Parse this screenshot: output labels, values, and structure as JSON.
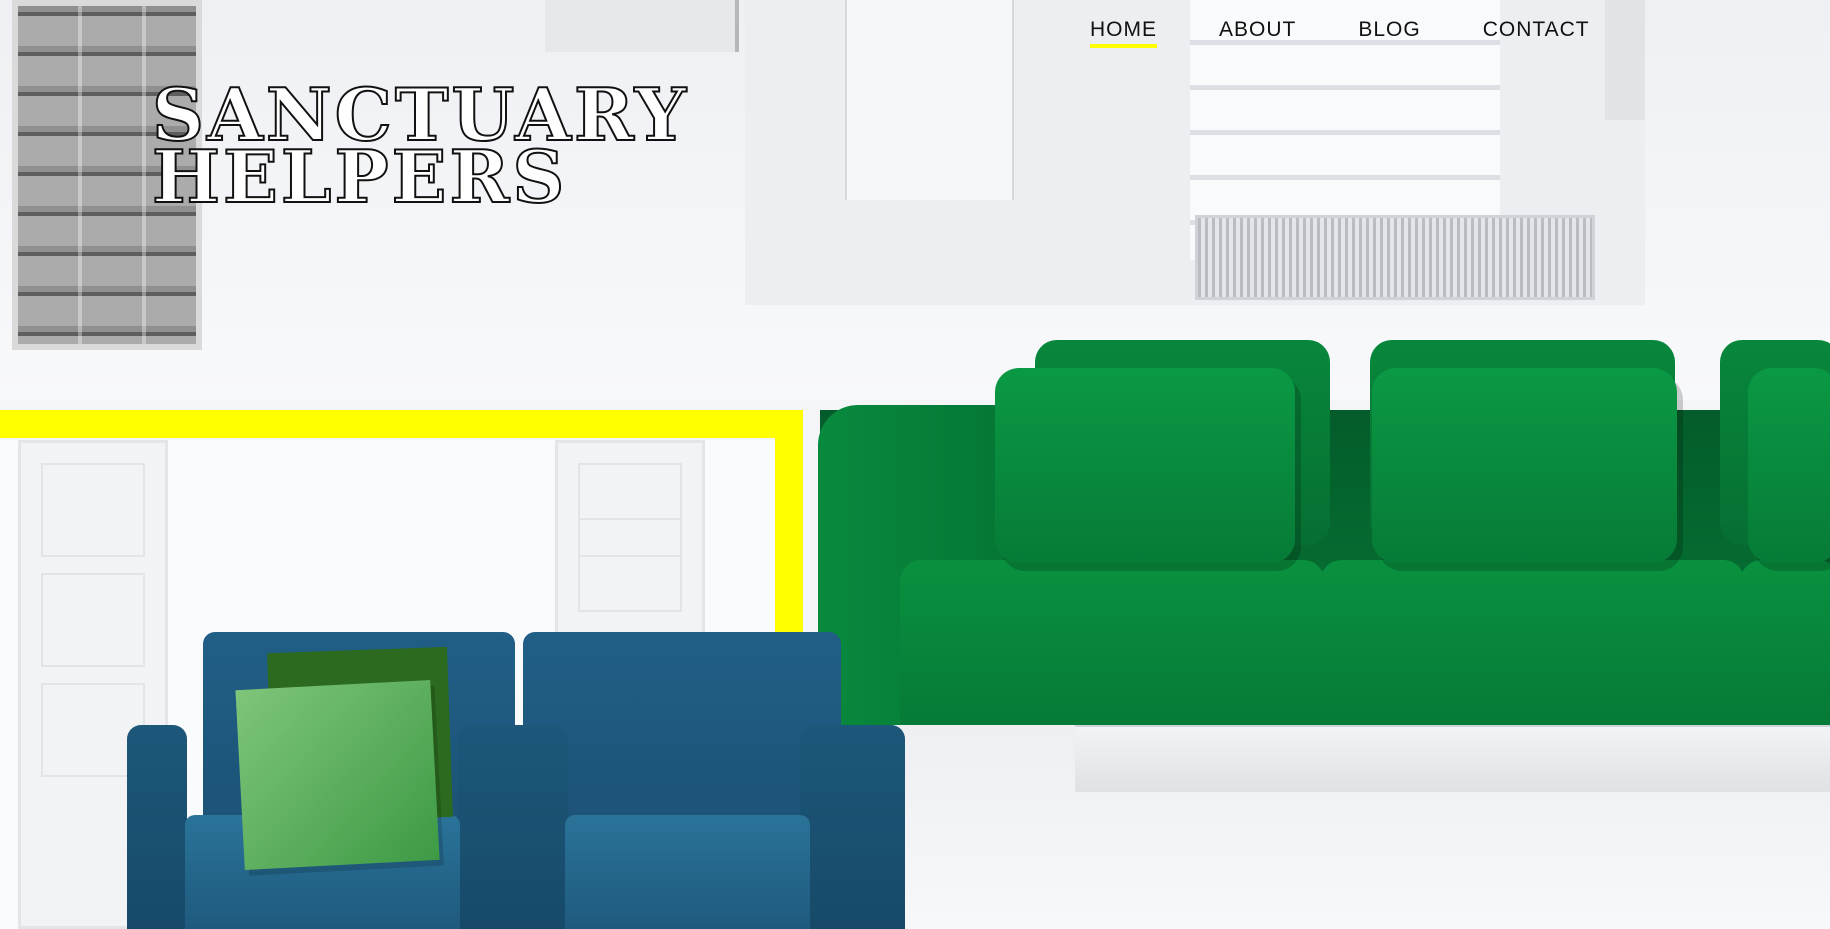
{
  "brand": {
    "line1": "SANCTUARY",
    "line2": "HELPERS"
  },
  "nav": {
    "items": [
      {
        "label": "HOME",
        "active": true
      },
      {
        "label": "ABOUT",
        "active": false
      },
      {
        "label": "BLOG",
        "active": false
      },
      {
        "label": "CONTACT",
        "active": false
      }
    ]
  },
  "colors": {
    "accent_yellow": "#ffff00",
    "sofa_green": "#067a37",
    "armchair_blue": "#1f5a7e",
    "text": "#111111"
  },
  "hero": {
    "image": "hero-interior-photo"
  }
}
